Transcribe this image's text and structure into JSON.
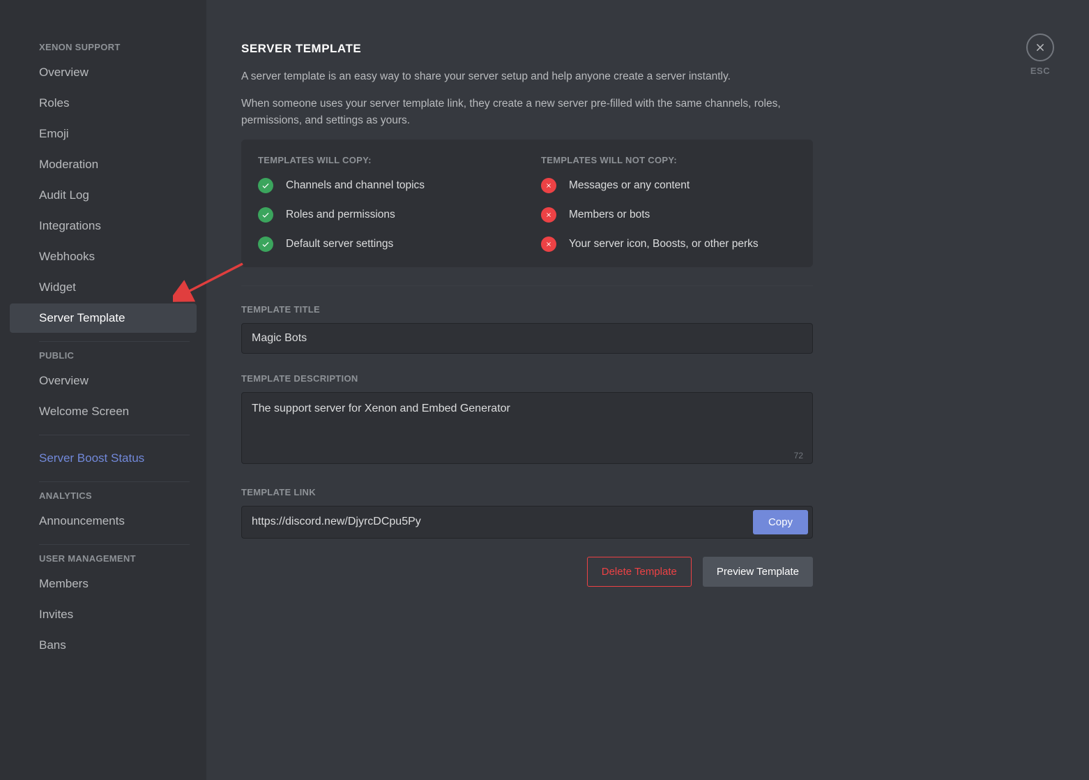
{
  "sidebar": {
    "sections": [
      {
        "header": "XENON SUPPORT",
        "items": [
          {
            "key": "overview",
            "label": "Overview"
          },
          {
            "key": "roles",
            "label": "Roles"
          },
          {
            "key": "emoji",
            "label": "Emoji"
          },
          {
            "key": "moderation",
            "label": "Moderation"
          },
          {
            "key": "audit-log",
            "label": "Audit Log"
          },
          {
            "key": "integrations",
            "label": "Integrations"
          },
          {
            "key": "webhooks",
            "label": "Webhooks"
          },
          {
            "key": "widget",
            "label": "Widget"
          },
          {
            "key": "server-template",
            "label": "Server Template",
            "active": true
          }
        ]
      },
      {
        "header": "PUBLIC",
        "items": [
          {
            "key": "public-overview",
            "label": "Overview"
          },
          {
            "key": "welcome-screen",
            "label": "Welcome Screen"
          }
        ]
      },
      {
        "header": null,
        "items": [
          {
            "key": "boost-status",
            "label": "Server Boost Status",
            "link": true
          }
        ]
      },
      {
        "header": "ANALYTICS",
        "items": [
          {
            "key": "announcements",
            "label": "Announcements"
          }
        ]
      },
      {
        "header": "USER MANAGEMENT",
        "items": [
          {
            "key": "members",
            "label": "Members"
          },
          {
            "key": "invites",
            "label": "Invites"
          },
          {
            "key": "bans",
            "label": "Bans"
          }
        ]
      }
    ]
  },
  "close": {
    "esc": "ESC"
  },
  "page": {
    "title": "SERVER TEMPLATE",
    "desc1": "A server template is an easy way to share your server setup and help anyone create a server instantly.",
    "desc2": "When someone uses your server template link, they create a new server pre-filled with the same channels, roles, permissions, and settings as yours.",
    "will_copy_header": "TEMPLATES WILL COPY:",
    "will_copy": [
      "Channels and channel topics",
      "Roles and permissions",
      "Default server settings"
    ],
    "will_not_copy_header": "TEMPLATES WILL NOT COPY:",
    "will_not_copy": [
      "Messages or any content",
      "Members or bots",
      "Your server icon, Boosts, or other perks"
    ],
    "title_label": "TEMPLATE TITLE",
    "title_value": "Magic Bots",
    "desc_label": "TEMPLATE DESCRIPTION",
    "desc_value": "The support server for Xenon and Embed Generator",
    "desc_remaining": "72",
    "link_label": "TEMPLATE LINK",
    "link_value": "https://discord.new/DjyrcDCpu5Py",
    "copy_btn": "Copy",
    "delete_btn": "Delete Template",
    "preview_btn": "Preview Template"
  }
}
